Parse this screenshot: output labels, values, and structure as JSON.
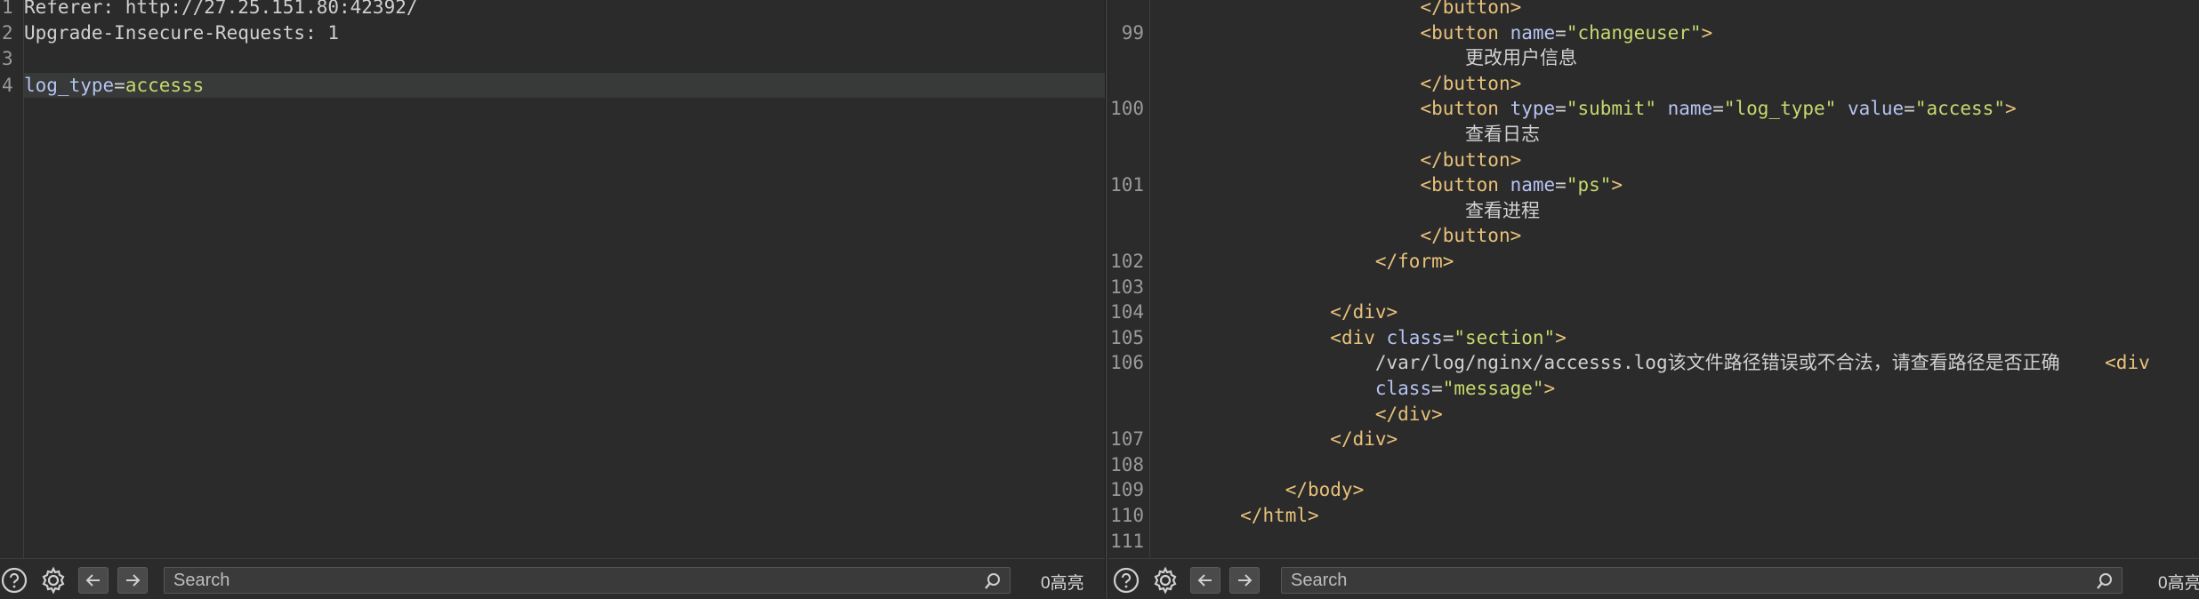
{
  "left_editor": {
    "lines": [
      {
        "num": "1",
        "segments": [
          {
            "t": "Referer: http://27.25.151.80:42392/",
            "c": "txt"
          }
        ]
      },
      {
        "num": "2",
        "segments": [
          {
            "t": "Upgrade-Insecure-Requests: 1",
            "c": "txt"
          }
        ]
      },
      {
        "num": "3",
        "segments": []
      },
      {
        "num": "4",
        "highlight": true,
        "segments": [
          {
            "t": "log_type",
            "c": "param"
          },
          {
            "t": "=",
            "c": "txt"
          },
          {
            "t": "accesss",
            "c": "val"
          }
        ]
      }
    ]
  },
  "right_editor": {
    "lines": [
      {
        "num": "",
        "segments": [
          {
            "t": "                        ",
            "c": "txt"
          },
          {
            "t": "</button>",
            "c": "tag"
          }
        ]
      },
      {
        "num": "99",
        "segments": [
          {
            "t": "                        ",
            "c": "txt"
          },
          {
            "t": "<button ",
            "c": "tag"
          },
          {
            "t": "name",
            "c": "attr"
          },
          {
            "t": "=",
            "c": "txt"
          },
          {
            "t": "\"changeuser\"",
            "c": "val"
          },
          {
            "t": ">",
            "c": "tag"
          }
        ]
      },
      {
        "num": "",
        "segments": [
          {
            "t": "                            更改用户信息",
            "c": "txt"
          }
        ]
      },
      {
        "num": "",
        "segments": [
          {
            "t": "                        ",
            "c": "txt"
          },
          {
            "t": "</button>",
            "c": "tag"
          }
        ]
      },
      {
        "num": "100",
        "segments": [
          {
            "t": "                        ",
            "c": "txt"
          },
          {
            "t": "<button ",
            "c": "tag"
          },
          {
            "t": "type",
            "c": "attr"
          },
          {
            "t": "=",
            "c": "txt"
          },
          {
            "t": "\"submit\" ",
            "c": "val"
          },
          {
            "t": "name",
            "c": "attr"
          },
          {
            "t": "=",
            "c": "txt"
          },
          {
            "t": "\"log_type\" ",
            "c": "val"
          },
          {
            "t": "value",
            "c": "attr"
          },
          {
            "t": "=",
            "c": "txt"
          },
          {
            "t": "\"access\"",
            "c": "val"
          },
          {
            "t": ">",
            "c": "tag"
          }
        ]
      },
      {
        "num": "",
        "segments": [
          {
            "t": "                            查看日志",
            "c": "txt"
          }
        ]
      },
      {
        "num": "",
        "segments": [
          {
            "t": "                        ",
            "c": "txt"
          },
          {
            "t": "</button>",
            "c": "tag"
          }
        ]
      },
      {
        "num": "101",
        "segments": [
          {
            "t": "                        ",
            "c": "txt"
          },
          {
            "t": "<button ",
            "c": "tag"
          },
          {
            "t": "name",
            "c": "attr"
          },
          {
            "t": "=",
            "c": "txt"
          },
          {
            "t": "\"ps\"",
            "c": "val"
          },
          {
            "t": ">",
            "c": "tag"
          }
        ]
      },
      {
        "num": "",
        "segments": [
          {
            "t": "                            查看进程",
            "c": "txt"
          }
        ]
      },
      {
        "num": "",
        "segments": [
          {
            "t": "                        ",
            "c": "txt"
          },
          {
            "t": "</button>",
            "c": "tag"
          }
        ]
      },
      {
        "num": "102",
        "segments": [
          {
            "t": "                    ",
            "c": "txt"
          },
          {
            "t": "</form>",
            "c": "tag"
          }
        ]
      },
      {
        "num": "103",
        "segments": []
      },
      {
        "num": "104",
        "segments": [
          {
            "t": "                ",
            "c": "txt"
          },
          {
            "t": "</div>",
            "c": "tag"
          }
        ]
      },
      {
        "num": "105",
        "segments": [
          {
            "t": "                ",
            "c": "txt"
          },
          {
            "t": "<div ",
            "c": "tag"
          },
          {
            "t": "class",
            "c": "attr"
          },
          {
            "t": "=",
            "c": "txt"
          },
          {
            "t": "\"section\"",
            "c": "val"
          },
          {
            "t": ">",
            "c": "tag"
          }
        ]
      },
      {
        "num": "106",
        "segments": [
          {
            "t": "                    /var/log/nginx/accesss.log该文件路径错误或不合法，请查看路径是否正确    ",
            "c": "txt"
          },
          {
            "t": "<div",
            "c": "tag"
          }
        ]
      },
      {
        "num": "",
        "segments": [
          {
            "t": "                    ",
            "c": "txt"
          },
          {
            "t": "class",
            "c": "attr"
          },
          {
            "t": "=",
            "c": "txt"
          },
          {
            "t": "\"message\"",
            "c": "val"
          },
          {
            "t": ">",
            "c": "tag"
          }
        ]
      },
      {
        "num": "",
        "segments": [
          {
            "t": "                    ",
            "c": "txt"
          },
          {
            "t": "</div>",
            "c": "tag"
          }
        ]
      },
      {
        "num": "107",
        "segments": [
          {
            "t": "                ",
            "c": "txt"
          },
          {
            "t": "</div>",
            "c": "tag"
          }
        ]
      },
      {
        "num": "108",
        "segments": []
      },
      {
        "num": "109",
        "segments": [
          {
            "t": "            ",
            "c": "txt"
          },
          {
            "t": "</body>",
            "c": "tag"
          }
        ]
      },
      {
        "num": "110",
        "segments": [
          {
            "t": "        ",
            "c": "txt"
          },
          {
            "t": "</html>",
            "c": "tag"
          }
        ]
      },
      {
        "num": "111",
        "segments": []
      }
    ]
  },
  "left_bar": {
    "search_placeholder": "Search",
    "highlight_count": "0高亮"
  },
  "right_bar": {
    "search_placeholder": "Search",
    "highlight_count": "0高亮"
  },
  "icons": {
    "help": "help-icon",
    "settings": "gear-icon",
    "back": "arrow-left-icon",
    "forward": "arrow-right-icon",
    "search": "search-icon"
  },
  "colors": {
    "background": "#2b2b2b",
    "tag": "#e8c17a",
    "attribute": "#b6c3f2",
    "value": "#c5d96e",
    "text": "#d0d0d0",
    "line_highlight": "#373a38"
  }
}
